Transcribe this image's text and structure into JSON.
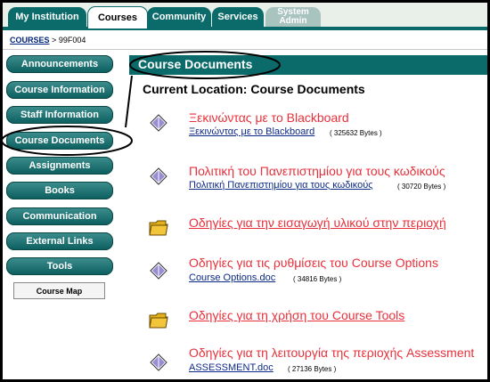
{
  "tabs": [
    {
      "label": "My Institution"
    },
    {
      "label": "Courses"
    },
    {
      "label": "Community"
    },
    {
      "label": "Services"
    },
    {
      "label_line1": "System",
      "label_line2": "Admin"
    }
  ],
  "breadcrumb": {
    "root": "COURSES",
    "separator": ">",
    "current": "99F004"
  },
  "nav": {
    "items": [
      "Announcements",
      "Course Information",
      "Staff Information",
      "Course Documents",
      "Assignments",
      "Books",
      "Communication",
      "External Links",
      "Tools"
    ],
    "course_map": "Course Map"
  },
  "content": {
    "header": "Course Documents",
    "location": "Current Location: Course Documents",
    "items": [
      {
        "icon": "document-icon",
        "title": "Ξεκινώντας με το Blackboard",
        "link": "Ξεκινώντας με το Blackboard",
        "size": "( 325632 Bytes )"
      },
      {
        "icon": "document-icon",
        "title": "Πολιτική του Πανεπιστημίου για τους κωδικούς",
        "link": "Πολιτική Πανεπιστημίου για τους κωδικούς",
        "size": "( 30720 Bytes )"
      },
      {
        "icon": "folder-icon",
        "title": "Οδηγίες για την εισαγωγή υλικού στην περιοχή"
      },
      {
        "icon": "document-icon",
        "title": "Οδηγίες για τις ρυθμίσεις του Course Options",
        "link": "Course Options.doc",
        "size": "( 34816 Bytes )"
      },
      {
        "icon": "folder-icon",
        "title": "Οδηγίες για τη χρήση του Course Tools"
      },
      {
        "icon": "document-icon",
        "title": "Οδηγίες για τη λειτουργία της περιοχής Assessment",
        "link": "ASSESSMENT.doc",
        "size": "( 27136 Bytes )"
      }
    ]
  },
  "colors": {
    "teal": "#0b6a6a",
    "item_red": "#e8313b",
    "link_blue": "#0d2a86"
  }
}
